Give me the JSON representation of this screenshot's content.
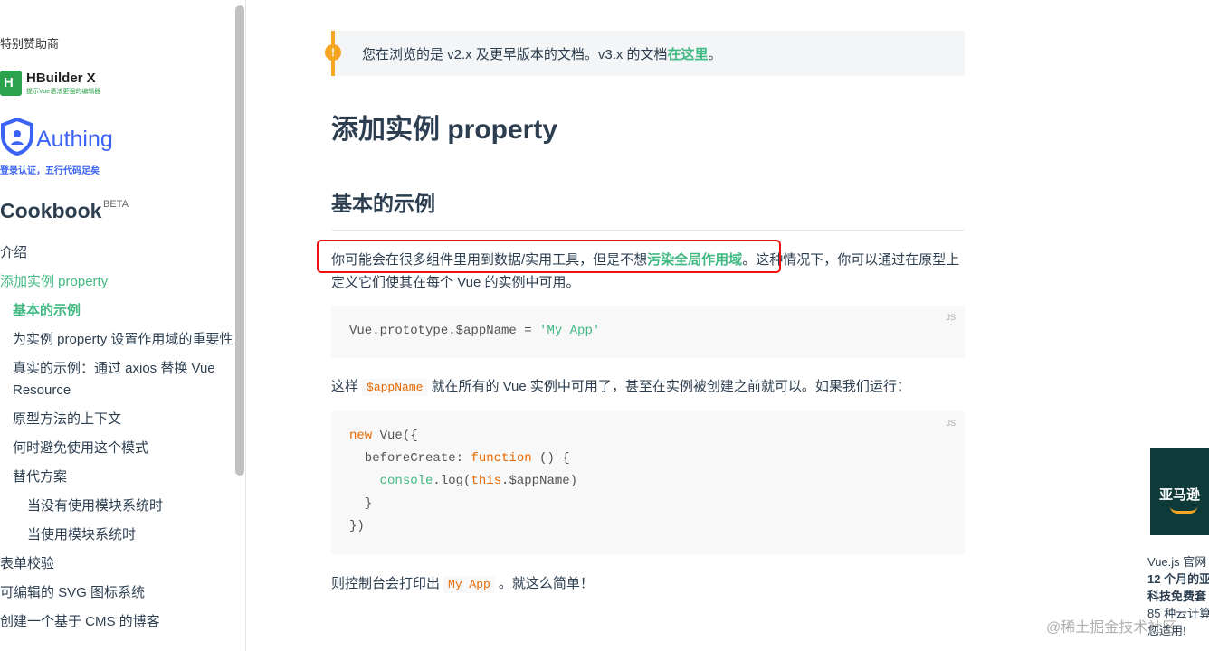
{
  "sidebar": {
    "sponsor_title": "特别赞助商",
    "hbuilder": {
      "name": "HBuilder X",
      "tagline": "提示Vue语法更强的编辑器"
    },
    "authing": {
      "name": "Authing",
      "tagline": "登录认证，五行代码足矣"
    },
    "cookbook_title": "Cookbook",
    "beta": "BETA",
    "items": [
      {
        "label": "介绍"
      },
      {
        "label": "添加实例 property"
      },
      {
        "label": "基本的示例"
      },
      {
        "label": "为实例 property 设置作用域的重要性"
      },
      {
        "label": "真实的示例：通过 axios 替换 Vue Resource"
      },
      {
        "label": "原型方法的上下文"
      },
      {
        "label": "何时避免使用这个模式"
      },
      {
        "label": "替代方案"
      },
      {
        "label": "当没有使用模块系统时"
      },
      {
        "label": "当使用模块系统时"
      },
      {
        "label": "表单校验"
      },
      {
        "label": "可编辑的 SVG 图标系统"
      },
      {
        "label": "创建一个基于 CMS 的博客"
      }
    ]
  },
  "main": {
    "tip": {
      "prefix": "您在浏览的是 v2.x 及更早版本的文档。v3.x 的文档",
      "link": "在这里",
      "suffix": "。",
      "icon": "!"
    },
    "title": "添加实例 property",
    "section_title": "基本的示例",
    "para1": {
      "prefix": "你可能会在很多组件里用到数据/实用工具，但是不想",
      "link": "污染全局作用域",
      "suffix": "。这种情况下，你可以通过在原型上定义它们使其在每个 Vue 的实例中可用。"
    },
    "code1": {
      "lang": "JS",
      "line1_a": "Vue.prototype.$appName = ",
      "line1_b": "'My App'"
    },
    "para2": {
      "prefix": "这样",
      "code": "$appName",
      "suffix": "就在所有的 Vue 实例中可用了，甚至在实例被创建之前就可以。如果我们运行："
    },
    "code2": {
      "lang": "JS",
      "l1_kw": "new",
      "l1_rest": " Vue({",
      "l2_a": "  beforeCreate: ",
      "l2_kw": "function",
      "l2_rest": " () {",
      "l3_a": "    ",
      "l3_fn": "console",
      "l3_b": ".log(",
      "l3_kw": "this",
      "l3_c": ".$appName)",
      "l4": "  }",
      "l5": "})"
    },
    "para3": {
      "prefix": "则控制台会打印出",
      "code": "My App",
      "suffix": "。就这么简单！"
    }
  },
  "ad": {
    "image_text": "亚马逊",
    "lines": [
      "Vue.js 官网",
      "12 个月的亚",
      "科技免费套",
      "85 种云计算",
      "您适用!"
    ]
  },
  "watermark": "@稀土掘金技术社区"
}
